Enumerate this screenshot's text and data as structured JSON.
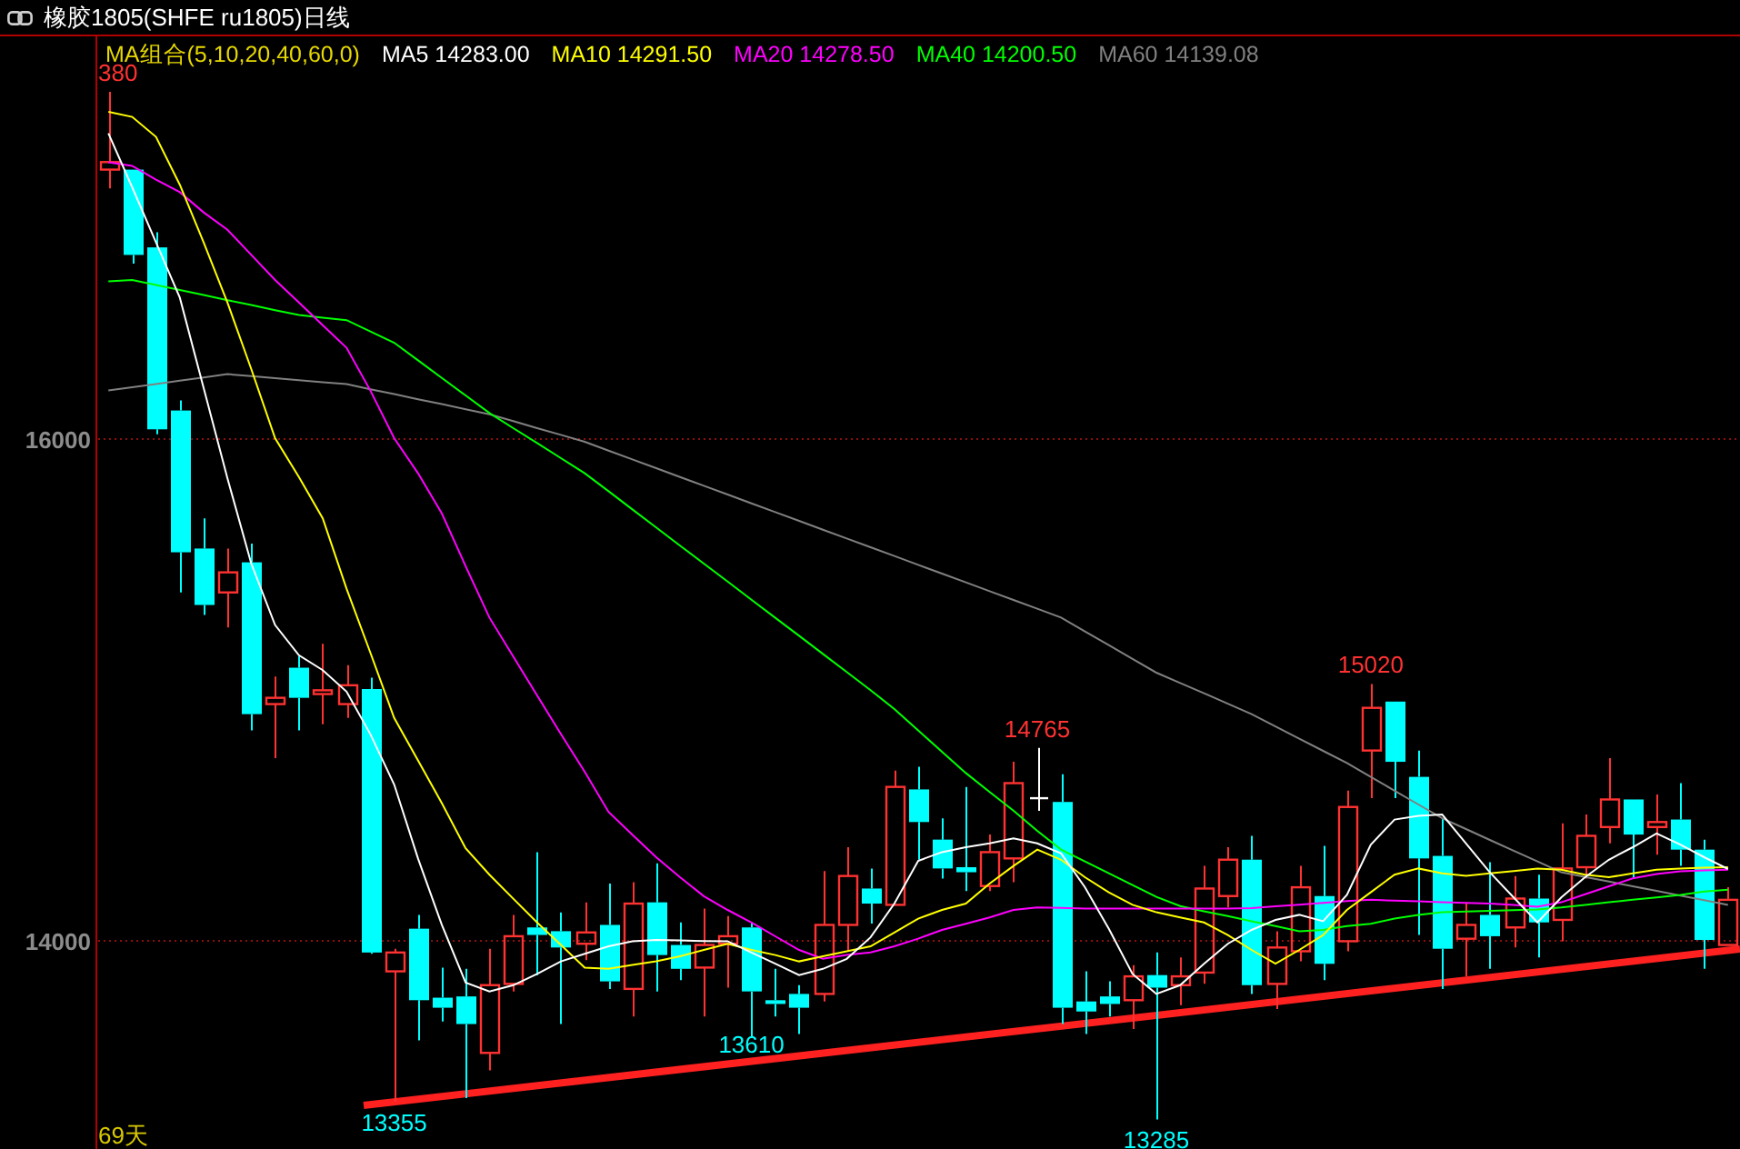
{
  "window": {
    "title": "橡胶1805(SHFE ru1805)日线"
  },
  "chart": {
    "legend": [
      {
        "label": "MA组合(5,10,20,40,60,0)",
        "color": "#e6d800"
      }
    ],
    "period_label": "69天",
    "chart_data": {
      "type": "candlestick",
      "ylim": [
        13167,
        17601
      ],
      "yticks": [
        14000,
        16000
      ],
      "ohlc": [
        [
          17070,
          17380,
          16995,
          17100
        ],
        [
          17070,
          17070,
          16695,
          16730
        ],
        [
          16760,
          16820,
          16015,
          16035
        ],
        [
          16110,
          16150,
          15385,
          15545
        ],
        [
          15560,
          15680,
          15295,
          15335
        ],
        [
          15385,
          15560,
          15245,
          15465
        ],
        [
          15505,
          15580,
          14835,
          14900
        ],
        [
          14940,
          15050,
          14725,
          14965
        ],
        [
          15085,
          15130,
          14835,
          14965
        ],
        [
          14980,
          15180,
          14860,
          14995
        ],
        [
          14940,
          15095,
          14885,
          15015
        ],
        [
          15000,
          15045,
          13945,
          13950
        ],
        [
          13875,
          13965,
          13355,
          13950
        ],
        [
          14045,
          14100,
          13600,
          13760
        ],
        [
          13770,
          13890,
          13675,
          13730
        ],
        [
          13775,
          13885,
          13370,
          13665
        ],
        [
          13550,
          13965,
          13480,
          13820
        ],
        [
          13825,
          14100,
          13795,
          14015
        ],
        [
          14050,
          14350,
          13860,
          14020
        ],
        [
          14035,
          14110,
          13665,
          13970
        ],
        [
          13985,
          14150,
          13920,
          14030
        ],
        [
          14060,
          14225,
          13805,
          13835
        ],
        [
          13805,
          14230,
          13695,
          14145
        ],
        [
          14150,
          14305,
          13795,
          13940
        ],
        [
          13980,
          14070,
          13840,
          13885
        ],
        [
          13890,
          14125,
          13695,
          13980
        ],
        [
          13985,
          14095,
          13810,
          14015
        ],
        [
          14050,
          14070,
          13610,
          13795
        ],
        [
          13760,
          13885,
          13695,
          13745
        ],
        [
          13785,
          13820,
          13625,
          13730
        ],
        [
          13785,
          14275,
          13755,
          14060
        ],
        [
          14060,
          14370,
          13955,
          14255
        ],
        [
          14205,
          14285,
          14065,
          14145
        ],
        [
          14140,
          14675,
          14140,
          14610
        ],
        [
          14600,
          14690,
          14320,
          14470
        ],
        [
          14400,
          14485,
          14245,
          14285
        ],
        [
          14290,
          14610,
          14195,
          14270
        ],
        [
          14215,
          14420,
          14195,
          14350
        ],
        [
          14325,
          14710,
          14230,
          14625
        ],
        [
          14565,
          14765,
          14515,
          14565
        ],
        [
          14550,
          14660,
          13665,
          13730
        ],
        [
          13755,
          13875,
          13625,
          13715
        ],
        [
          13775,
          13835,
          13695,
          13745
        ],
        [
          13760,
          13900,
          13645,
          13855
        ],
        [
          13860,
          13950,
          13285,
          13810
        ],
        [
          13820,
          13930,
          13740,
          13855
        ],
        [
          13870,
          14295,
          13825,
          14205
        ],
        [
          14175,
          14370,
          14130,
          14320
        ],
        [
          14320,
          14415,
          13785,
          13820
        ],
        [
          13825,
          14035,
          13725,
          13970
        ],
        [
          13955,
          14295,
          13915,
          14210
        ],
        [
          14175,
          14375,
          13840,
          13905
        ],
        [
          13995,
          14595,
          13955,
          14530
        ],
        [
          14755,
          15020,
          14565,
          14925
        ],
        [
          14950,
          14950,
          14565,
          14710
        ],
        [
          14650,
          14755,
          14020,
          14325
        ],
        [
          14335,
          14485,
          13805,
          13965
        ],
        [
          14005,
          14150,
          13855,
          14060
        ],
        [
          14100,
          14310,
          13885,
          14015
        ],
        [
          14050,
          14255,
          13970,
          14165
        ],
        [
          14165,
          14260,
          13930,
          14070
        ],
        [
          14080,
          14465,
          13995,
          14285
        ],
        [
          14290,
          14500,
          14245,
          14415
        ],
        [
          14450,
          14725,
          14385,
          14560
        ],
        [
          14560,
          14560,
          14245,
          14420
        ],
        [
          14450,
          14580,
          14340,
          14470
        ],
        [
          14480,
          14625,
          14295,
          14360
        ],
        [
          14360,
          14400,
          13885,
          14000
        ],
        [
          13980,
          14210,
          13980,
          14160
        ]
      ],
      "annotations": [
        {
          "text": "380",
          "y": 17380
        },
        {
          "text": "14765",
          "y": 14765
        },
        {
          "text": "15020",
          "y": 15020
        },
        {
          "text": "13355",
          "y": 13355
        },
        {
          "text": "13610",
          "y": 13610
        },
        {
          "text": "13285",
          "y": 13285
        }
      ]
    },
    "moving_averages": {
      "chart_data": {
        "type": "line",
        "ylim": [
          13167,
          17601
        ],
        "series": [
          {
            "name": "MA5 14283.00",
            "color": "#ffffff",
            "values": [
              17215,
              17000,
              16780,
              16560,
              16200,
              15840,
              15500,
              15255,
              15135,
              15075,
              14990,
              14820,
              14620,
              14325,
              14060,
              13830,
              13795,
              13820,
              13865,
              13915,
              13945,
              13975,
              13995,
              14000,
              13998,
              13996,
              13995,
              13950,
              13905,
              13860,
              13885,
              13925,
              14010,
              14145,
              14315,
              14350,
              14370,
              14385,
              14405,
              14385,
              14345,
              14210,
              14045,
              13865,
              13785,
              13820,
              13905,
              13985,
              14040,
              14080,
              14100,
              14075,
              14180,
              14380,
              14480,
              14495,
              14500,
              14385,
              14270,
              14170,
              14070,
              14170,
              14250,
              14320,
              14370,
              14425,
              14380,
              14330,
              14283
            ]
          },
          {
            "name": "MA10 14291.50",
            "color": "#ffff00",
            "values": [
              17300,
              17280,
              17200,
              17010,
              16780,
              16540,
              16275,
              16000,
              15845,
              15680,
              15400,
              15145,
              14885,
              14715,
              14545,
              14365,
              14260,
              14165,
              14070,
              13980,
              13890,
              13885,
              13900,
              13915,
              13935,
              13960,
              13985,
              13960,
              13940,
              13915,
              13935,
              13955,
              13975,
              14030,
              14085,
              14120,
              14145,
              14225,
              14295,
              14360,
              14320,
              14250,
              14190,
              14140,
              14110,
              14090,
              14070,
              14020,
              13960,
              13905,
              13960,
              14020,
              14120,
              14190,
              14260,
              14285,
              14265,
              14255,
              14265,
              14275,
              14285,
              14280,
              14260,
              14250,
              14265,
              14280,
              14285,
              14288,
              14290
            ]
          },
          {
            "name": "MA20 14278.50",
            "color": "#ff00ff",
            "values": [
              17100,
              17085,
              17030,
              16980,
              16900,
              16830,
              16730,
              16630,
              16540,
              16450,
              16360,
              16190,
              16000,
              15860,
              15700,
              15490,
              15285,
              15130,
              14975,
              14820,
              14670,
              14510,
              14420,
              14330,
              14250,
              14175,
              14120,
              14070,
              14015,
              13960,
              13925,
              13940,
              13950,
              13975,
              14005,
              14040,
              14065,
              14090,
              14120,
              14130,
              14128,
              14125,
              14125,
              14125,
              14125,
              14125,
              14125,
              14125,
              14127,
              14134,
              14141,
              14148,
              14155,
              14160,
              14157,
              14154,
              14151,
              14148,
              14145,
              14139,
              14133,
              14150,
              14182,
              14214,
              14246,
              14263,
              14273,
              14278,
              14280
            ]
          },
          {
            "name": "MA40 14200.50",
            "color": "#00ff00",
            "values": [
              16625,
              16630,
              16610,
              16590,
              16570,
              16550,
              16530,
              16510,
              16490,
              16480,
              16470,
              16425,
              16380,
              16310,
              16240,
              16170,
              16100,
              16040,
              15980,
              15920,
              15860,
              15788,
              15716,
              15644,
              15572,
              15500,
              15428,
              15356,
              15284,
              15212,
              15140,
              15068,
              14996,
              14920,
              14835,
              14750,
              14665,
              14590,
              14515,
              14435,
              14360,
              14313,
              14266,
              14219,
              14172,
              14135,
              14115,
              14095,
              14075,
              14055,
              14035,
              14040,
              14055,
              14065,
              14085,
              14100,
              14110,
              14113,
              14116,
              14119,
              14122,
              14130,
              14140,
              14150,
              14160,
              14170,
              14180,
              14193,
              14200
            ]
          },
          {
            "name": "MA60 14139.08",
            "color": "#808080",
            "values": [
              16190,
              16203,
              16216,
              16229,
              16242,
              16255,
              16247,
              16239,
              16231,
              16223,
              16215,
              16195,
              16175,
              16155,
              16135,
              16115,
              16095,
              16068,
              16040,
              16013,
              15985,
              15950,
              15915,
              15880,
              15845,
              15810,
              15775,
              15740,
              15705,
              15670,
              15635,
              15600,
              15565,
              15530,
              15495,
              15460,
              15425,
              15390,
              15355,
              15320,
              15285,
              15230,
              15175,
              15120,
              15065,
              15024,
              14983,
              14941,
              14900,
              14851,
              14802,
              14754,
              14705,
              14650,
              14595,
              14540,
              14485,
              14442,
              14399,
              14356,
              14313,
              14270,
              14251,
              14233,
              14214,
              14196,
              14177,
              14159,
              14140
            ]
          }
        ]
      }
    }
  }
}
